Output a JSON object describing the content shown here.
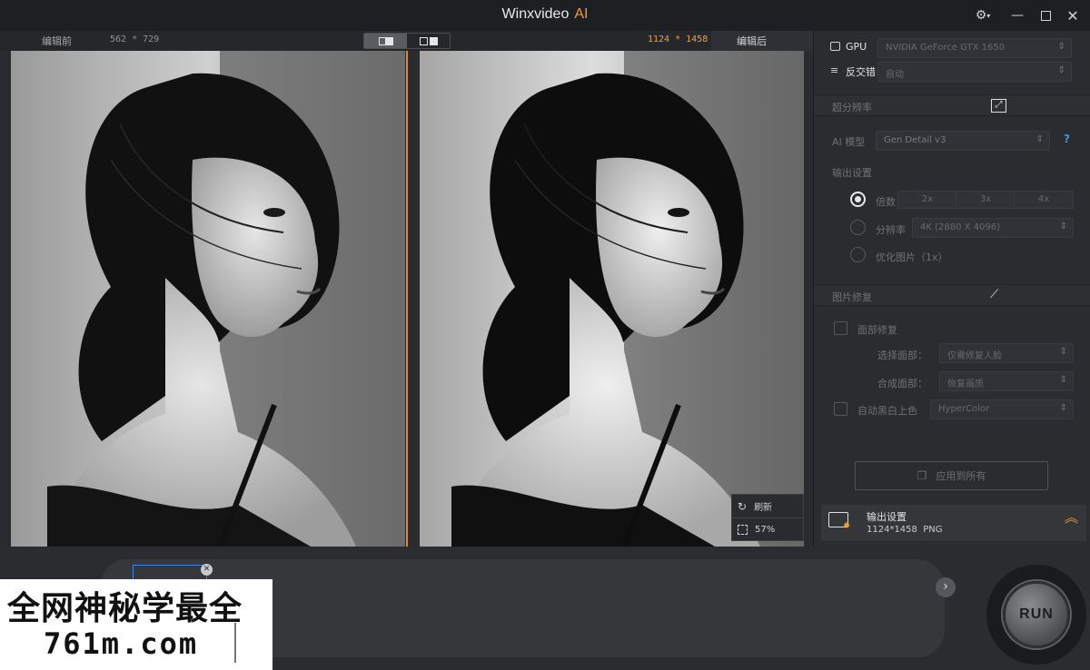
{
  "app": {
    "title": "Winxvideo",
    "title_ai": "AI"
  },
  "compare": {
    "before_label": "编辑前",
    "before_size": "562 * 729",
    "after_size": "1124 * 1458",
    "after_label": "编辑后"
  },
  "zoom_panel": {
    "refresh_label": "刷新",
    "zoom_level": "57%"
  },
  "settings": {
    "gpu_label": "GPU",
    "gpu_value": "NVIDIA GeForce GTX 1650",
    "deinterlace_label": "反交错",
    "deinterlace_value": "自动"
  },
  "super_resolution": {
    "section_title": "超分辨率",
    "ai_model_label": "AI 模型",
    "ai_model_value": "Gen Detail v3",
    "help": "?",
    "output_settings_label": "输出设置",
    "scale_label": "倍数",
    "scale_options": [
      "2x",
      "3x",
      "4x"
    ],
    "resolution_label": "分辨率",
    "resolution_value": "4K (2880 X 4096)",
    "optimize_label": "优化图片（1x）"
  },
  "restoration": {
    "section_title": "图片修复",
    "face_restore_label": "面部修复",
    "select_face_label": "选择面部：",
    "select_face_value": "仅需修复人脸",
    "blend_label": "合成面部：",
    "blend_value": "恢复画质",
    "colorize_label": "自动黑白上色",
    "colorize_value": "HyperColor"
  },
  "apply_all_label": "应用到所有",
  "output": {
    "title": "输出设置",
    "detail": "1124*1458  PNG"
  },
  "run_label": "RUN",
  "watermark": {
    "line1": "全网神秘学最全",
    "line2": "761m.com"
  }
}
